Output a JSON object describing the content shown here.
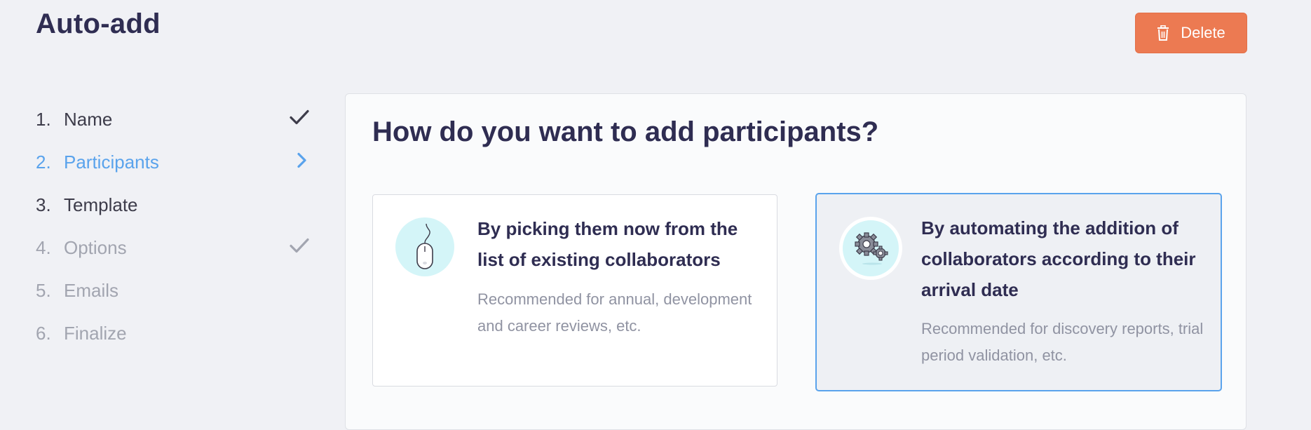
{
  "header": {
    "title": "Auto-add",
    "delete_label": "Delete",
    "delete_icon": "trash-icon",
    "delete_color": "#ec7a52"
  },
  "steps": [
    {
      "number": "1.",
      "label": "Name",
      "state": "done",
      "state_icon": "check-icon"
    },
    {
      "number": "2.",
      "label": "Participants",
      "state": "current",
      "state_icon": "chevron-right-icon"
    },
    {
      "number": "3.",
      "label": "Template",
      "state": "done",
      "state_icon": ""
    },
    {
      "number": "4.",
      "label": "Options",
      "state": "pending",
      "state_icon": "check-icon"
    },
    {
      "number": "5.",
      "label": "Emails",
      "state": "pending",
      "state_icon": ""
    },
    {
      "number": "6.",
      "label": "Finalize",
      "state": "pending",
      "state_icon": ""
    }
  ],
  "main": {
    "question": "How do you want to add participants?",
    "options": [
      {
        "title": "By picking them now from the list of existing collaborators",
        "description": "Recommended for annual, development and career reviews, etc.",
        "icon": "mouse-icon",
        "selected": false
      },
      {
        "title": "By automating the addition of collaborators according to their arrival date",
        "description": "Recommended for discovery reports, trial period validation, etc.",
        "icon": "gears-icon",
        "selected": true
      }
    ]
  },
  "colors": {
    "accent": "#5aa3ec",
    "title": "#2f2d52",
    "muted": "#a2a5b0",
    "icon_bg": "#d4f5f8"
  }
}
